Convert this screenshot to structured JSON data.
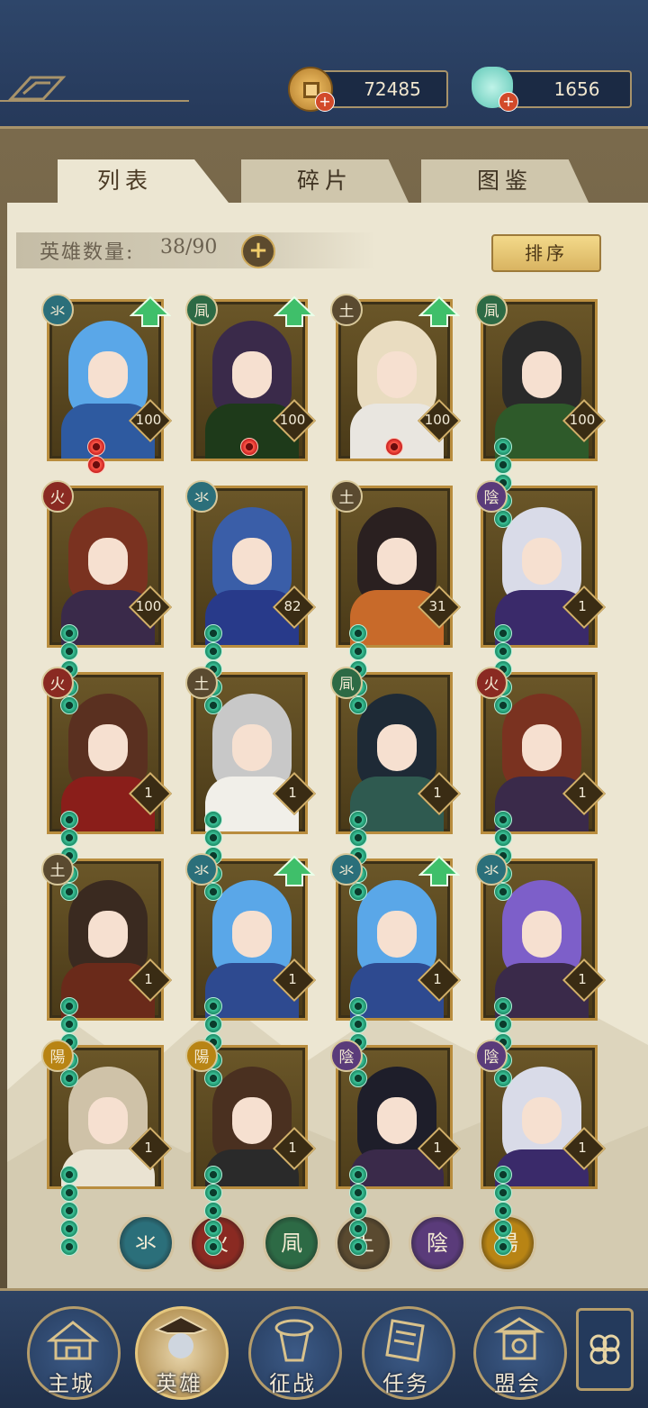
{
  "resources": {
    "coins": "72485",
    "jade": "1656"
  },
  "tabs": [
    {
      "label": "列表",
      "active": true
    },
    {
      "label": "碎片",
      "active": false
    },
    {
      "label": "图鉴",
      "active": false
    }
  ],
  "hero_count": {
    "label": "英雄数量:",
    "value": "38/90"
  },
  "sort_label": "排序",
  "heroes": [
    {
      "element": "水",
      "glyph": "氺",
      "level": "100",
      "stars": 2,
      "star_type": "red",
      "upgrade": true
    },
    {
      "element": "风",
      "glyph": "凬",
      "level": "100",
      "stars": 1,
      "star_type": "red",
      "upgrade": true
    },
    {
      "element": "土",
      "glyph": "土",
      "level": "100",
      "stars": 1,
      "star_type": "red",
      "upgrade": true
    },
    {
      "element": "风",
      "glyph": "凬",
      "level": "100",
      "stars": 5,
      "star_type": "green",
      "upgrade": false
    },
    {
      "element": "火",
      "glyph": "火",
      "level": "100",
      "stars": 5,
      "star_type": "green",
      "upgrade": false
    },
    {
      "element": "水",
      "glyph": "氺",
      "level": "82",
      "stars": 5,
      "star_type": "green",
      "upgrade": false
    },
    {
      "element": "土",
      "glyph": "土",
      "level": "31",
      "stars": 5,
      "star_type": "green",
      "upgrade": false
    },
    {
      "element": "阴",
      "glyph": "陰",
      "level": "1",
      "stars": 5,
      "star_type": "green",
      "upgrade": false
    },
    {
      "element": "火",
      "glyph": "火",
      "level": "1",
      "stars": 5,
      "star_type": "green",
      "upgrade": false
    },
    {
      "element": "土",
      "glyph": "土",
      "level": "1",
      "stars": 5,
      "star_type": "green",
      "upgrade": false
    },
    {
      "element": "风",
      "glyph": "凬",
      "level": "1",
      "stars": 5,
      "star_type": "green",
      "upgrade": false
    },
    {
      "element": "火",
      "glyph": "火",
      "level": "1",
      "stars": 5,
      "star_type": "green",
      "upgrade": false
    },
    {
      "element": "土",
      "glyph": "土",
      "level": "1",
      "stars": 5,
      "star_type": "green",
      "upgrade": false
    },
    {
      "element": "水",
      "glyph": "氺",
      "level": "1",
      "stars": 5,
      "star_type": "green",
      "upgrade": true
    },
    {
      "element": "水",
      "glyph": "氺",
      "level": "1",
      "stars": 5,
      "star_type": "green",
      "upgrade": true
    },
    {
      "element": "水",
      "glyph": "氺",
      "level": "1",
      "stars": 5,
      "star_type": "green",
      "upgrade": false
    },
    {
      "element": "阳",
      "glyph": "陽",
      "level": "1",
      "stars": 5,
      "star_type": "green",
      "upgrade": false
    },
    {
      "element": "阳",
      "glyph": "陽",
      "level": "1",
      "stars": 5,
      "star_type": "green",
      "upgrade": false
    },
    {
      "element": "阴",
      "glyph": "陰",
      "level": "1",
      "stars": 5,
      "star_type": "green",
      "upgrade": false
    },
    {
      "element": "阴",
      "glyph": "陰",
      "level": "1",
      "stars": 5,
      "star_type": "green",
      "upgrade": false
    }
  ],
  "element_colors": {
    "水": "#2b6f7a",
    "火": "#8a2a22",
    "风": "#2d6a45",
    "土": "#5a4a30",
    "阴": "#5a3b7a",
    "阳": "#b88414"
  },
  "filters": [
    {
      "element": "水",
      "glyph": "氺"
    },
    {
      "element": "火",
      "glyph": "火"
    },
    {
      "element": "风",
      "glyph": "凬"
    },
    {
      "element": "土",
      "glyph": "土"
    },
    {
      "element": "阴",
      "glyph": "陰"
    },
    {
      "element": "阳",
      "glyph": "陽"
    }
  ],
  "nav": [
    {
      "label": "主城",
      "icon": "city-icon",
      "active": false
    },
    {
      "label": "英雄",
      "icon": "hero-icon",
      "active": true
    },
    {
      "label": "征战",
      "icon": "battle-icon",
      "active": false
    },
    {
      "label": "任务",
      "icon": "task-icon",
      "active": false
    },
    {
      "label": "盟会",
      "icon": "guild-icon",
      "active": false
    }
  ]
}
